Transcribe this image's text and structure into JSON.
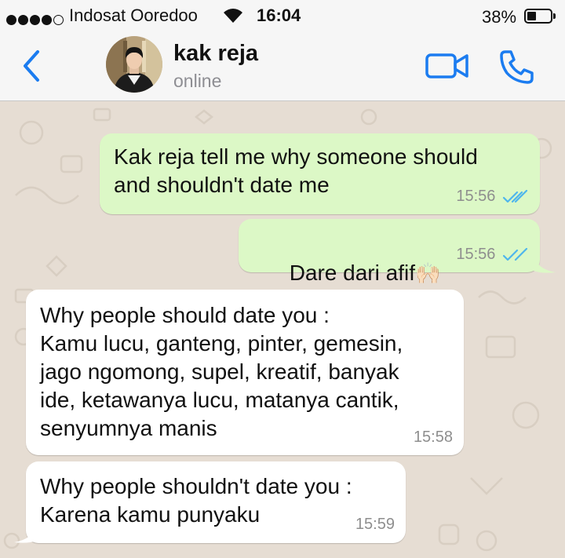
{
  "status_bar": {
    "carrier": "Indosat Ooredoo",
    "time": "16:04",
    "battery_percent": "38%",
    "battery_level": 0.38,
    "signal_bars_filled": 4,
    "signal_bars_total": 5
  },
  "header": {
    "contact_name": "kak reja",
    "contact_status": "online",
    "accent_color": "#1b7cf0"
  },
  "messages": [
    {
      "direction": "outgoing",
      "text": "Kak reja tell me why someone should\nand shouldn't date me",
      "time": "15:56",
      "status": "read"
    },
    {
      "direction": "outgoing",
      "text": "Dare dari afif",
      "emoji": "🙌🏻",
      "time": "15:56",
      "status": "read"
    },
    {
      "direction": "incoming",
      "text": "Why people should date you :\nKamu lucu, ganteng, pinter, gemesin,\njago ngomong, supel, kreatif, banyak\nide, ketawanya lucu, matanya cantik,\nsenyumnya manis",
      "time": "15:58"
    },
    {
      "direction": "incoming",
      "text": "Why people shouldn't date you :\nKarena kamu punyaku",
      "time": "15:59"
    }
  ],
  "colors": {
    "outgoing_bubble": "#dcf8c6",
    "incoming_bubble": "#ffffff",
    "chat_background": "#e6ddd3",
    "read_ticks": "#4fb6ec"
  }
}
